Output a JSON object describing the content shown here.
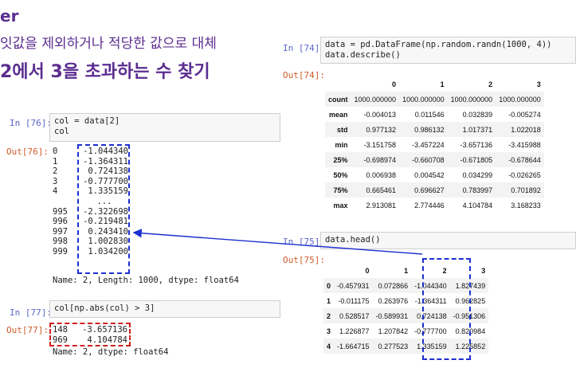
{
  "slide": {
    "title_partial": "er",
    "subtitle": "잇값을 제외하거나 적당한 값으로 대체",
    "heading": "2에서 3을 초과하는 수 찾기"
  },
  "colors": {
    "title": "#5b2d90",
    "in_prompt": "#5a66c8",
    "out_prompt": "#d05a2a",
    "blue_dash": "#1b2fd0",
    "red_dash": "#d31f1f"
  },
  "cell76": {
    "in_prompt": "In [76]:",
    "code": "col = data[2]\ncol",
    "out_prompt": "Out[76]:",
    "index": [
      "0",
      "1",
      "2",
      "3",
      "4",
      "",
      "995",
      "996",
      "997",
      "998",
      "999"
    ],
    "values": [
      "-1.044340",
      "-1.364311",
      " 0.724138",
      "-0.777700",
      " 1.335159",
      "...",
      "-2.322698",
      "-0.219481",
      " 0.243410",
      " 1.002830",
      " 1.034200"
    ],
    "footer": "Name: 2, Length: 1000, dtype: float64"
  },
  "cell77": {
    "in_prompt": "In [77]:",
    "code": "col[np.abs(col) > 3]",
    "out_prompt": "Out[77]:",
    "rows": [
      {
        "index": "148",
        "value": "-3.657136"
      },
      {
        "index": "969",
        "value": " 4.104784"
      }
    ],
    "footer": "Name: 2, dtype: float64"
  },
  "cell74": {
    "in_prompt": "In [74]:",
    "code": "data = pd.DataFrame(np.random.randn(1000, 4))\ndata.describe()",
    "out_prompt": "Out[74]:",
    "columns": [
      "0",
      "1",
      "2",
      "3"
    ],
    "rows": [
      {
        "label": "count",
        "values": [
          "1000.000000",
          "1000.000000",
          "1000.000000",
          "1000.000000"
        ]
      },
      {
        "label": "mean",
        "values": [
          "-0.004013",
          "0.011546",
          "0.032839",
          "-0.005274"
        ]
      },
      {
        "label": "std",
        "values": [
          "0.977132",
          "0.986132",
          "1.017371",
          "1.022018"
        ]
      },
      {
        "label": "min",
        "values": [
          "-3.151758",
          "-3.457224",
          "-3.657136",
          "-3.415988"
        ]
      },
      {
        "label": "25%",
        "values": [
          "-0.698974",
          "-0.660708",
          "-0.671805",
          "-0.678644"
        ]
      },
      {
        "label": "50%",
        "values": [
          "0.006938",
          "0.004542",
          "0.034299",
          "-0.026265"
        ]
      },
      {
        "label": "75%",
        "values": [
          "0.665461",
          "0.696627",
          "0.783997",
          "0.701892"
        ]
      },
      {
        "label": "max",
        "values": [
          "2.913081",
          "2.774446",
          "4.104784",
          "3.168233"
        ]
      }
    ]
  },
  "cell75": {
    "in_prompt": "In [75]:",
    "code": "data.head()",
    "out_prompt": "Out[75]:",
    "columns": [
      "0",
      "1",
      "2",
      "3"
    ],
    "rows": [
      {
        "label": "0",
        "values": [
          "-0.457931",
          "0.072866",
          "-1.044340",
          "1.827439"
        ]
      },
      {
        "label": "1",
        "values": [
          "-0.011175",
          "0.263976",
          "-1.364311",
          "0.962825"
        ]
      },
      {
        "label": "2",
        "values": [
          "0.528517",
          "-0.589931",
          "0.724138",
          "-0.951306"
        ]
      },
      {
        "label": "3",
        "values": [
          "1.226877",
          "1.207842",
          "-0.777700",
          "0.820984"
        ]
      },
      {
        "label": "4",
        "values": [
          "-1.664715",
          "0.277523",
          "1.335159",
          "1.225852"
        ]
      }
    ]
  }
}
